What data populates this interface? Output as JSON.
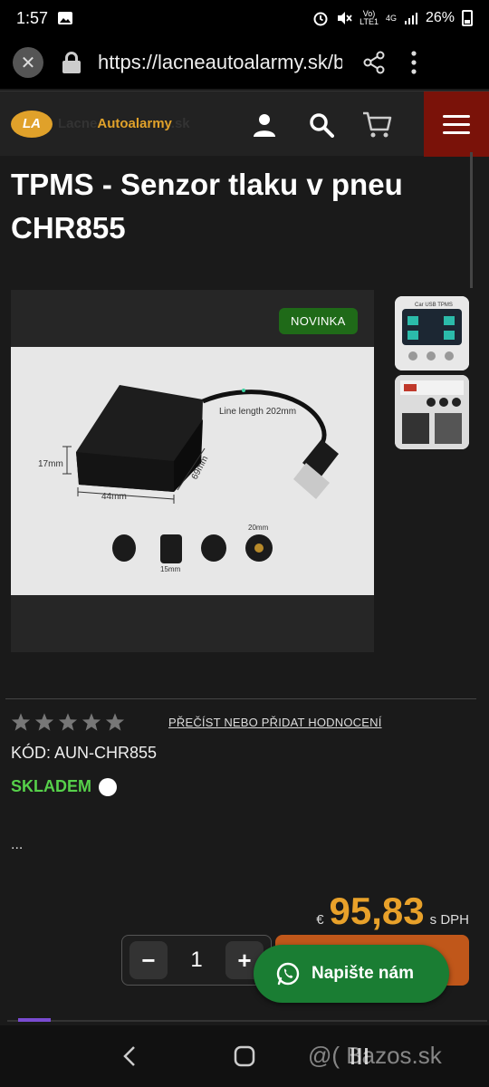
{
  "status_bar": {
    "time": "1:57",
    "network_top": "Vo)",
    "network_bottom": "LTE1",
    "network_type": "4G",
    "battery": "26%"
  },
  "browser": {
    "url": "https://lacneautoalarmy.sk/b"
  },
  "site": {
    "logo_mark": "LA",
    "logo_text_1": "Lacne",
    "logo_text_2": "Autoalarmy",
    "logo_text_3": ".sk"
  },
  "product": {
    "title": "TPMS - Senzor tlaku v pneu CHR855",
    "badge": "NOVINKA",
    "image_labels": {
      "line_length": "Line length 202mm",
      "height": "17mm",
      "width": "44mm",
      "depth": "69mm",
      "cap_width": "20mm",
      "cap_small": "15mm"
    },
    "thumb_title": "Car USB TPMS",
    "review_link": "PŘEČÍST NEBO PŘIDAT HODNOCENÍ",
    "rating": 0,
    "code": "KÓD: AUN-CHR855",
    "stock": "SKLADEM",
    "description": "...",
    "price_currency": "€",
    "price": "95,83",
    "price_note": "s DPH",
    "quantity": "1",
    "qty_minus": "−",
    "qty_plus": "+"
  },
  "chat": {
    "label": "Napište nám"
  },
  "watermark": "@( Bazos.sk",
  "colors": {
    "accent_orange": "#e8a12a",
    "menu_red": "#7a1209",
    "stock_green": "#56d04a",
    "badge_green": "#1f6a18",
    "whatsapp_green": "#1a7d33"
  }
}
